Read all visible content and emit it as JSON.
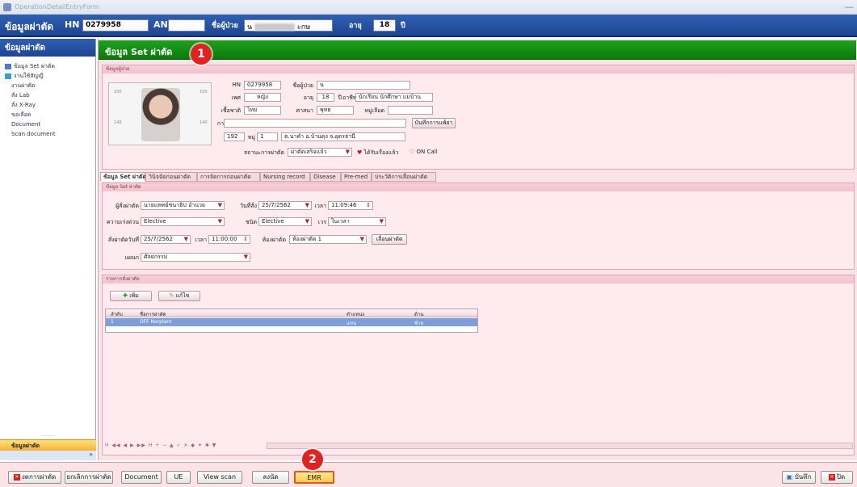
{
  "window": {
    "title": "OperationDetailEntryForm"
  },
  "header": {
    "title": "ข้อมูลผ่าตัด",
    "hn_label": "HN",
    "hn_value": "0279958",
    "an_label": "AN",
    "an_value": "",
    "name_label": "ชื่อผู้ป่วย",
    "name_value": "น",
    "name_suffix": "ะกษ",
    "age_label": "อายุ",
    "age_value": "18",
    "age_unit": "ปี"
  },
  "sidebar": {
    "title": "ข้อมูลผ่าตัด",
    "items": [
      {
        "label": "ข้อมูล Set ผ่าตัด"
      },
      {
        "label": "งานใช้สัญญี"
      },
      {
        "label": "งานผ่าตัด"
      },
      {
        "label": "สั่ง Lab"
      },
      {
        "label": "สั่ง X-Ray"
      },
      {
        "label": "ขอเลือด"
      },
      {
        "label": "Document"
      },
      {
        "label": "Scan document"
      }
    ],
    "footer_selected": "ข้อมูลผ่าตัด"
  },
  "main": {
    "section_title": "ข้อมูล Set ผ่าตัด",
    "badge1": "1",
    "patient_group": "ข้อมูลผู้ป่วย",
    "patient": {
      "hn_label": "HN",
      "hn": "0279958",
      "name_label": "ชื่อผู้ป่วย",
      "name": "น",
      "sex_label": "เพศ",
      "sex": "หญิง",
      "age_label": "อายุ",
      "age": "18",
      "age_unit": "ปี",
      "occupation_label": "อาชีพ",
      "occupation": "นักเรียน นักศึกษา แม่บ้าน",
      "nationality_label": "เชื้อชาติ",
      "nationality": "ไทย",
      "religion_label": "ศาสนา",
      "religion": "พุทธ",
      "blood_label": "หมู่เลือด",
      "blood": "",
      "allergy_label": "การแพ้ยา",
      "allergy": "",
      "allergy_button": "บันทึกการแพ้ยา",
      "address_label": "ที่อยู่",
      "house_no": "192",
      "moo_label": "หมู่",
      "moo": "1",
      "address": "ต.นาคำ อ.บ้านดุง จ.อุดรธานี",
      "op_status_label": "สถานะการผ่าตัด",
      "op_status": "ผ่าตัดเสร็จแล้ว",
      "received_label": "ได้รับเรื่องแล้ว",
      "oncall_label": "ON Call"
    },
    "tabs": [
      {
        "label": "ข้อมูล Set ผ่าตัด"
      },
      {
        "label": "วินิจฉัยก่อนผ่าตัด"
      },
      {
        "label": "การจัดการก่อนผ่าตัด"
      },
      {
        "label": "Nursing record"
      },
      {
        "label": "Disease"
      },
      {
        "label": "Pre-med"
      },
      {
        "label": "ประวัติการเลื่อนผ่าตัด"
      }
    ],
    "set_group": "ข้อมูล Set ผ่าตัด",
    "set": {
      "doctor_label": "ผู้สั่งผ่าตัด",
      "doctor": "นายแพทย์ชนาธิป อำนวย",
      "order_date_label": "วันที่สั่ง",
      "order_date": "25/7/2562",
      "time_label": "เวลา",
      "order_time": "11:09:46",
      "urgency_label": "ความเร่งด่วน",
      "urgency": "Elective",
      "type_label": "ชนิด",
      "type": "Elective",
      "shift_label": "เวร",
      "shift": "ในเวลา",
      "op_date_label": "สั่งผ่าตัดวันที่",
      "op_date": "25/7/2562",
      "op_time_label": "เวลา",
      "op_time": "11:00:00",
      "room_label": "ห้องผ่าตัด",
      "room": "ห้องผ่าตัด 1",
      "postpone_button": "เลื่อนผ่าตัด",
      "dept_label": "แผนก",
      "dept": "ศัลยกรรม"
    },
    "list_group": "รายการสั่งผ่าตัด",
    "list_buttons": {
      "add": "เพิ่ม",
      "edit": "แก้ไข"
    },
    "grid": {
      "headers": [
        "ลำดับ",
        "ชื่อการผ่าตัด",
        "ตำแหน่ง",
        "ด้าน"
      ],
      "rows": [
        [
          "1",
          "OFF Norplant",
          "แขน",
          "ซ้าย"
        ]
      ]
    },
    "nav_text": "H ◀◀ ◀ ▶ ▶▶ H + − ▲ ✓ ✕ ◆ ✦ ✱ ▼"
  },
  "footer": {
    "cancel_op": "งดการผ่าตัด",
    "cancel_cancel": "ยกเลิกการผ่าตัด",
    "document": "Document",
    "ue": "UE",
    "view_scan": "View scan",
    "sign": "ลงนัด",
    "emr": "EMR",
    "badge2": "2",
    "save": "บันทึก",
    "close": "ปิด"
  },
  "colors": {
    "header_blue": "#1d4694",
    "green_bar": "#0a7a0a",
    "panel_pink": "#fbe3e8",
    "badge_red": "#e32121",
    "emr_outline": "#e05a1a"
  }
}
